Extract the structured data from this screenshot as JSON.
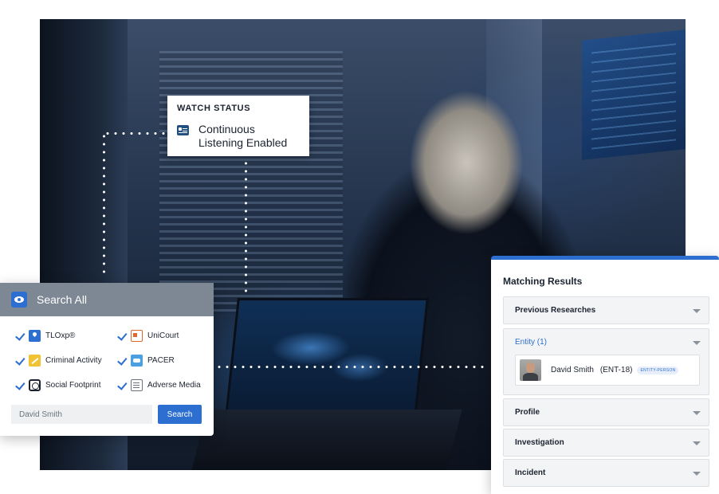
{
  "watch_status": {
    "title": "WATCH STATUS",
    "icon": "id-card-icon",
    "status_text": "Continuous Listening Enabled"
  },
  "search_panel": {
    "title": "Search All",
    "icon": "eye-icon",
    "sources": [
      {
        "label": "TLOxp®",
        "icon": "map-pin-icon",
        "checked": true
      },
      {
        "label": "UniCourt",
        "icon": "unicourt-icon",
        "checked": true
      },
      {
        "label": "Criminal Activity",
        "icon": "criminal-activity-icon",
        "checked": true
      },
      {
        "label": "PACER",
        "icon": "pacer-icon",
        "checked": true
      },
      {
        "label": "Social Footprint",
        "icon": "fingerprint-icon",
        "checked": true
      },
      {
        "label": "Adverse Media",
        "icon": "document-icon",
        "checked": true
      }
    ],
    "input_value": "David Smith",
    "button_label": "Search",
    "accent_color": "#2d6fd0"
  },
  "results_panel": {
    "title": "Matching Results",
    "sections": [
      {
        "label": "Previous Researches",
        "expanded": false
      },
      {
        "label": "Entity (1)",
        "expanded": true
      },
      {
        "label": "Profile",
        "expanded": false
      },
      {
        "label": "Investigation",
        "expanded": false
      },
      {
        "label": "Incident",
        "expanded": false
      }
    ],
    "entity": {
      "name": "David Smith",
      "id": "(ENT-18)",
      "badge": "ENTITY-PERSON"
    }
  }
}
